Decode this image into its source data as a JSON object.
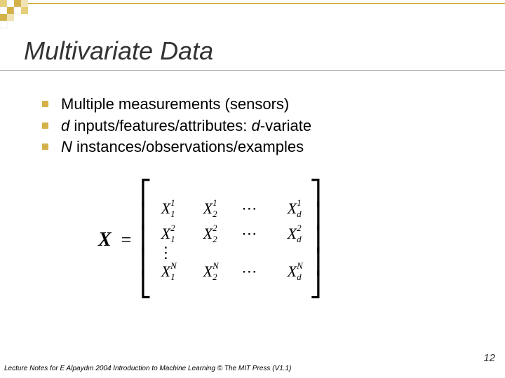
{
  "title": "Multivariate Data",
  "bullets": {
    "b1": "Multiple measurements (sensors)",
    "b2_d": "d",
    "b2_mid": " inputs/features/attributes: ",
    "b2_d2": "d",
    "b2_tail": "-variate",
    "b3_N": "N",
    "b3_tail": " instances/observations/examples"
  },
  "matrix": {
    "lhs": "X",
    "eq": "=",
    "X": "X",
    "sub1": "1",
    "sub2": "2",
    "subd": "d",
    "sup1": "1",
    "sup2": "2",
    "supN": "N",
    "cdots": "⋯",
    "vdots": "⋮"
  },
  "footer": "Lecture Notes for E Alpaydın 2004 Introduction to Machine Learning © The MIT Press (V1.1)",
  "pagenum": "12"
}
